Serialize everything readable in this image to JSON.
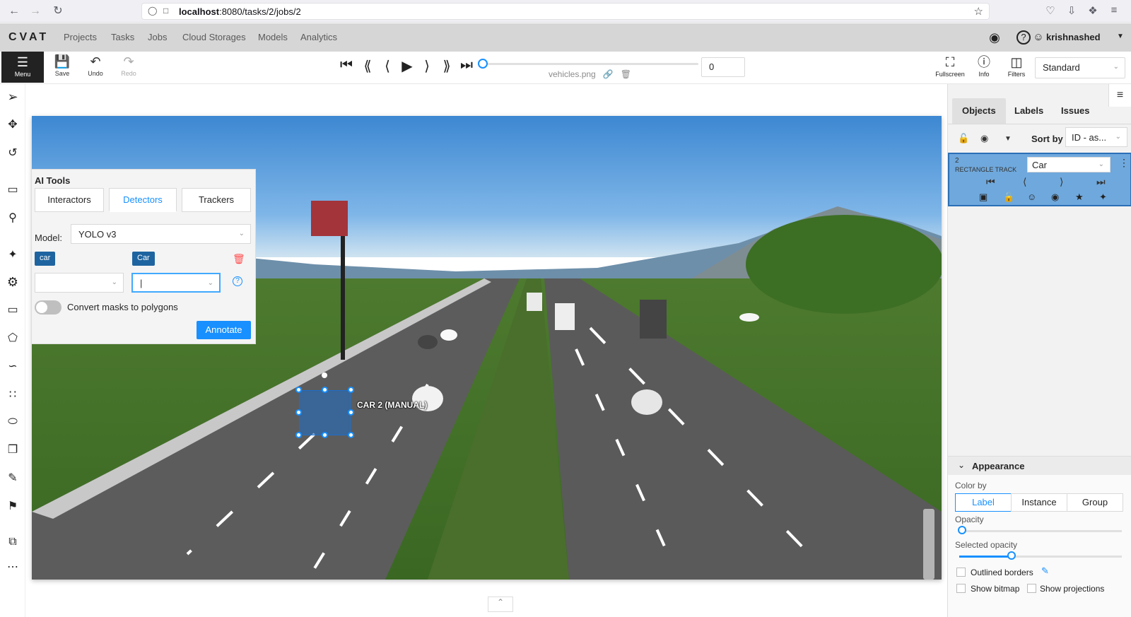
{
  "browser": {
    "url_host": "localhost",
    "url_path": ":8080/tasks/2/jobs/2"
  },
  "header": {
    "logo": "CVAT",
    "nav": [
      "Projects",
      "Tasks",
      "Jobs",
      "Cloud Storages",
      "Models",
      "Analytics"
    ],
    "user": "krishnashed"
  },
  "toolbar": {
    "menu_label": "Menu",
    "save_label": "Save",
    "undo_label": "Undo",
    "redo_label": "Redo",
    "filename": "vehicles.png",
    "frame_value": "0",
    "fullscreen_label": "Fullscreen",
    "info_label": "Info",
    "filters_label": "Filters",
    "workspace": "Standard"
  },
  "ai_tools": {
    "title": "AI Tools",
    "tabs": [
      "Interactors",
      "Detectors",
      "Trackers"
    ],
    "active_tab": "Detectors",
    "model_label": "Model:",
    "model_value": "YOLO v3",
    "model_tag": "car",
    "task_tag": "Car",
    "convert_label": "Convert masks to polygons",
    "annotate_label": "Annotate"
  },
  "canvas": {
    "object_label": "CAR 2 (MANUAL)"
  },
  "right_panel": {
    "tabs": [
      "Objects",
      "Labels",
      "Issues"
    ],
    "sort_label": "Sort by",
    "sort_value": "ID - as...",
    "object": {
      "id": "2",
      "type": "RECTANGLE TRACK",
      "label": "Car"
    },
    "appearance": {
      "title": "Appearance",
      "color_by_label": "Color by",
      "color_by_options": [
        "Label",
        "Instance",
        "Group"
      ],
      "color_by_selected": "Label",
      "opacity_label": "Opacity",
      "selected_opacity_label": "Selected opacity",
      "outlined_borders_label": "Outlined borders",
      "show_bitmap_label": "Show bitmap",
      "show_projections_label": "Show projections"
    }
  },
  "colors": {
    "accent": "#1890ff",
    "header_bg": "#d6d6d6",
    "menu_bg": "#222222",
    "tag_bg": "#1e64a0",
    "object_card_bg": "#6fa8dc"
  }
}
